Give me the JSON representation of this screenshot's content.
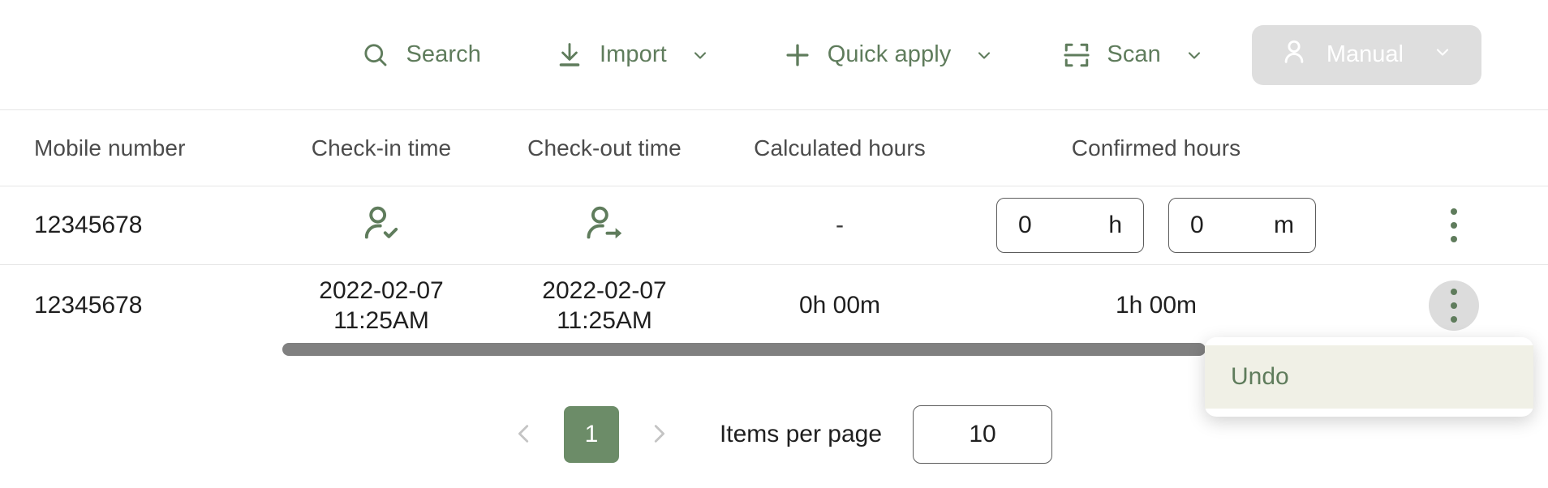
{
  "toolbar": {
    "search_label": "Search",
    "import_label": "Import",
    "quick_apply_label": "Quick apply",
    "scan_label": "Scan",
    "manual_label": "Manual",
    "icons": {
      "search": "search-icon",
      "import": "download-icon",
      "quick_apply": "plus-icon",
      "scan": "scan-frame-icon",
      "manual": "person-icon",
      "caret": "chevron-down-icon"
    },
    "colors": {
      "accent_green": "#5f7c5c",
      "manual_button_bg": "#dedede",
      "manual_button_text": "#ffffff"
    }
  },
  "table": {
    "columns": [
      "Mobile number",
      "Check-in time",
      "Check-out time",
      "Calculated hours",
      "Confirmed hours"
    ],
    "rows": [
      {
        "mobile_number": "12345678",
        "check_in": {
          "type": "icon",
          "icon": "person-check-icon"
        },
        "check_out": {
          "type": "icon",
          "icon": "person-arrow-icon"
        },
        "calculated_hours": "-",
        "confirmed_hours": {
          "type": "inputs",
          "hours_value": "0",
          "hours_unit": "h",
          "minutes_value": "0",
          "minutes_unit": "m"
        },
        "action_icon": "kebab-menu-icon",
        "action_active": false
      },
      {
        "mobile_number": "12345678",
        "check_in": {
          "type": "text",
          "date": "2022-02-07",
          "time": "11:25AM"
        },
        "check_out": {
          "type": "text",
          "date": "2022-02-07",
          "time": "11:25AM"
        },
        "calculated_hours": "0h 00m",
        "confirmed_hours": {
          "type": "text",
          "value": "1h 00m"
        },
        "action_icon": "kebab-menu-icon",
        "action_active": true
      }
    ]
  },
  "dropdown": {
    "visible": true,
    "items": [
      "Undo"
    ],
    "highlight_bg": "#f0f0e6",
    "text_color": "#5f7c5c"
  },
  "scrollbar": {
    "orientation": "horizontal",
    "thumb_color": "#808080"
  },
  "pagination": {
    "prev_icon": "chevron-left-icon",
    "next_icon": "chevron-right-icon",
    "current_page": "1",
    "items_per_page_label": "Items per page",
    "items_per_page_value": "10",
    "active_page_bg": "#6c8c68"
  }
}
